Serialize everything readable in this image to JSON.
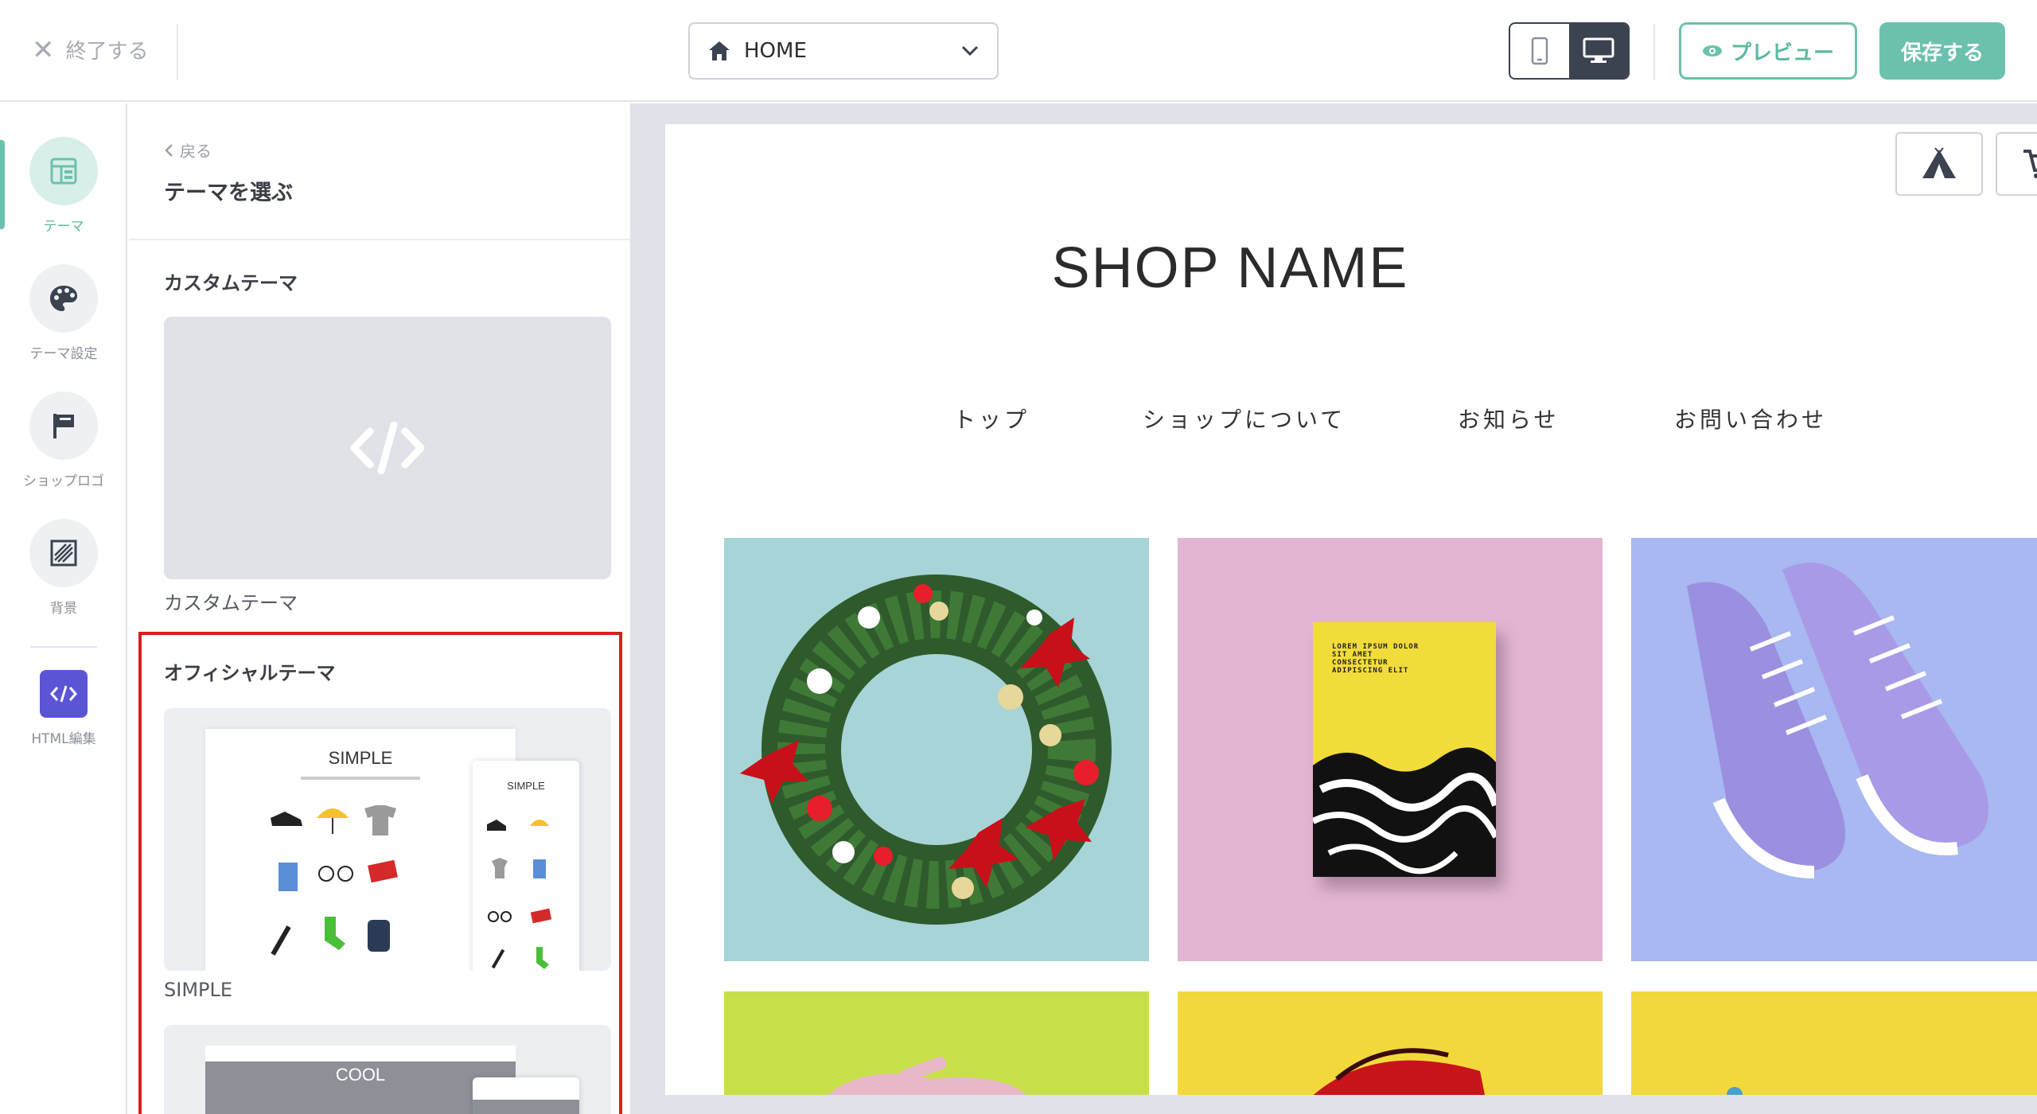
{
  "topbar": {
    "exit_label": "終了する",
    "page_select": "HOME",
    "preview_label": "プレビュー",
    "save_label": "保存する"
  },
  "rail": {
    "items": [
      {
        "label": "テーマ",
        "icon": "layout-icon",
        "active": true
      },
      {
        "label": "テーマ設定",
        "icon": "palette-icon"
      },
      {
        "label": "ショップロゴ",
        "icon": "flag-icon"
      },
      {
        "label": "背景",
        "icon": "pattern-icon"
      },
      {
        "label": "HTML編集",
        "icon": "code-icon"
      }
    ]
  },
  "panel": {
    "back_label": "戻る",
    "title": "テーマを選ぶ",
    "custom_section": "カスタムテーマ",
    "custom_caption": "カスタムテーマ",
    "official_section": "オフィシャルテーマ",
    "themes": [
      {
        "name": "SIMPLE",
        "mock_title": "SIMPLE"
      },
      {
        "name": "COOL",
        "mock_title": "COOL"
      }
    ]
  },
  "preview": {
    "shop_name": "SHOP NAME",
    "nav": [
      "トップ",
      "ショップについて",
      "お知らせ",
      "お問い合わせ"
    ],
    "book_text": "LOREM IPSUM DOLOR SIT AMET CONSECTETUR ADIPISCING ELIT"
  },
  "colors": {
    "accent": "#6cc1ad",
    "dark": "#3b4250",
    "highlight": "#d81e1e",
    "html_icon_bg": "#5b55d6"
  }
}
